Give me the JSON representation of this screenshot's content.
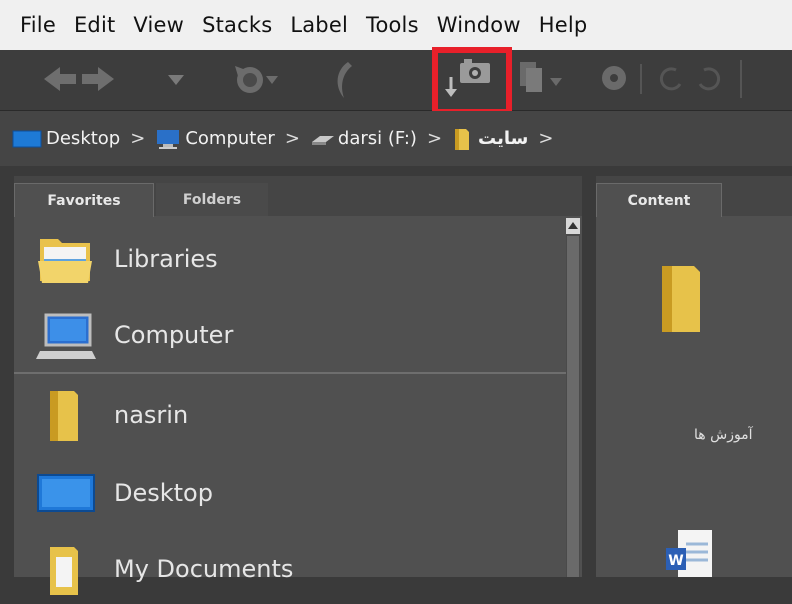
{
  "menubar": {
    "items": [
      "File",
      "Edit",
      "View",
      "Stacks",
      "Label",
      "Tools",
      "Window",
      "Help"
    ]
  },
  "toolbar": {
    "buttons": [
      "back-icon",
      "forward-icon",
      "dropdown-icon",
      "recent-icon",
      "boomerang-icon",
      "get-photos-from-camera-icon",
      "copy-icon",
      "rotate-icon",
      "rotate-left-icon",
      "rotate-right-icon"
    ],
    "highlight_color": "#e8202a"
  },
  "breadcrumb": {
    "items": [
      {
        "label": "Desktop",
        "icon": "desktop-icon"
      },
      {
        "label": "Computer",
        "icon": "computer-icon"
      },
      {
        "label": "darsi (F:)",
        "icon": "drive-icon"
      },
      {
        "label": "سایت",
        "icon": "folder-icon"
      }
    ],
    "separator": ">"
  },
  "left_panel": {
    "tabs": [
      "Favorites",
      "Folders"
    ],
    "active_tab": "Favorites",
    "items": [
      {
        "label": "Libraries",
        "icon": "libraries-icon"
      },
      {
        "label": "Computer",
        "icon": "computer-icon"
      },
      {
        "label": "nasrin",
        "icon": "user-folder-icon"
      },
      {
        "label": "Desktop",
        "icon": "desktop-icon"
      },
      {
        "label": "My Documents",
        "icon": "documents-icon"
      }
    ]
  },
  "right_panel": {
    "tab": "Content",
    "item_label": "آموزش ها"
  },
  "colors": {
    "menubar_bg": "#f0f0f0",
    "toolbar_bg": "#3d3d3d",
    "panel_bg": "#505050",
    "folder_yellow": "#e7c24a"
  }
}
